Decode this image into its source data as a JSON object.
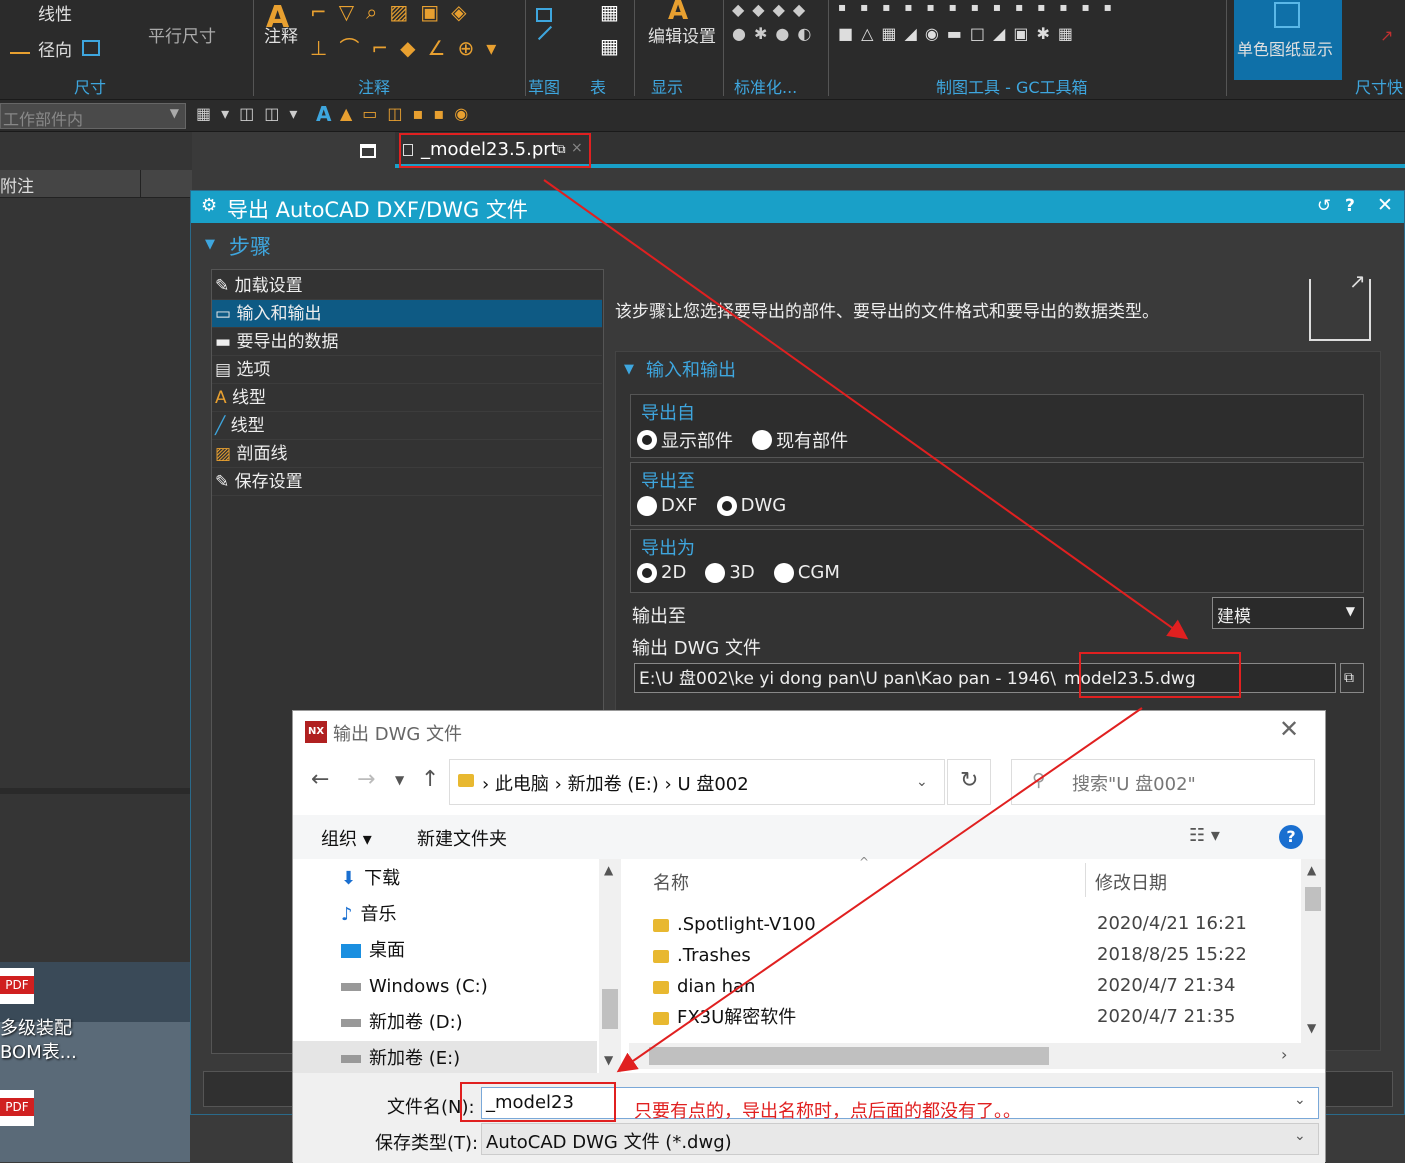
{
  "ribbon": {
    "items": {
      "xianxing": "线性",
      "jingxiang": "径向",
      "pingxing": "平行尺寸",
      "zhushi_btn": "注释",
      "bianji": "编辑设置",
      "danse": "单色图纸显示"
    },
    "groups": {
      "chicun": "尺寸",
      "zhushi": "注释",
      "caotu": "草图",
      "biao": "表",
      "xianshi": "显示",
      "biaozhunhua": "标准化...",
      "gc": "制图工具 - GC工具箱",
      "chicunkuai": "尺寸快"
    }
  },
  "toolbar2": {
    "filter": "工作部件内"
  },
  "tab": {
    "label": "_model23.5.prt"
  },
  "leftpanel": {
    "header": "附注"
  },
  "dialog": {
    "title": "导出 AutoCAD DXF/DWG 文件",
    "steps_title": "步骤",
    "steps": [
      "加载设置",
      "输入和输出",
      "要导出的数据",
      "选项",
      "线型",
      "线型",
      "剖面线",
      "保存设置"
    ],
    "description": "该步骤让您选择要导出的部件、要导出的文件格式和要导出的数据类型。",
    "io_title": "输入和输出",
    "export_from": {
      "label": "导出自",
      "options": [
        "显示部件",
        "现有部件"
      ],
      "selected": 0
    },
    "export_to": {
      "label": "导出至",
      "options": [
        "DXF",
        "DWG"
      ],
      "selected": 1
    },
    "export_as": {
      "label": "导出为",
      "options": [
        "2D",
        "3D",
        "CGM"
      ],
      "selected": 0
    },
    "output_to": {
      "label": "输出至",
      "value": "建模"
    },
    "output_file": {
      "label": "输出 DWG 文件",
      "path": "E:\\U 盘002\\ke yi dong pan\\U pan\\Kao   pan - 1946\\",
      "filename": "model23.5.dwg"
    }
  },
  "filedialog": {
    "title": "输出 DWG 文件",
    "breadcrumb": [
      "此电脑",
      "新加卷 (E:)",
      "U 盘002"
    ],
    "search_placeholder": "搜索\"U 盘002\"",
    "organize": "组织",
    "new_folder": "新建文件夹",
    "tree": [
      "下载",
      "音乐",
      "桌面",
      "Windows (C:)",
      "新加卷 (D:)",
      "新加卷 (E:)"
    ],
    "columns": {
      "name": "名称",
      "date": "修改日期"
    },
    "files": [
      {
        "name": ".Spotlight-V100",
        "date": "2020/4/21 16:21"
      },
      {
        "name": ".Trashes",
        "date": "2018/8/25 15:22"
      },
      {
        "name": "dian han",
        "date": "2020/4/7 21:34"
      },
      {
        "name": "FX3U解密软件",
        "date": "2020/4/7 21:35"
      }
    ],
    "filename_label": "文件名(N):",
    "filename_value": "_model23",
    "filetype_label": "保存类型(T):",
    "filetype_value": "AutoCAD DWG 文件 (*.dwg)"
  },
  "annotation": "只要有点的，导出名称时，点后面的都没有了。。",
  "desktop": {
    "label1": "多级装配",
    "label2": "BOM表..."
  }
}
